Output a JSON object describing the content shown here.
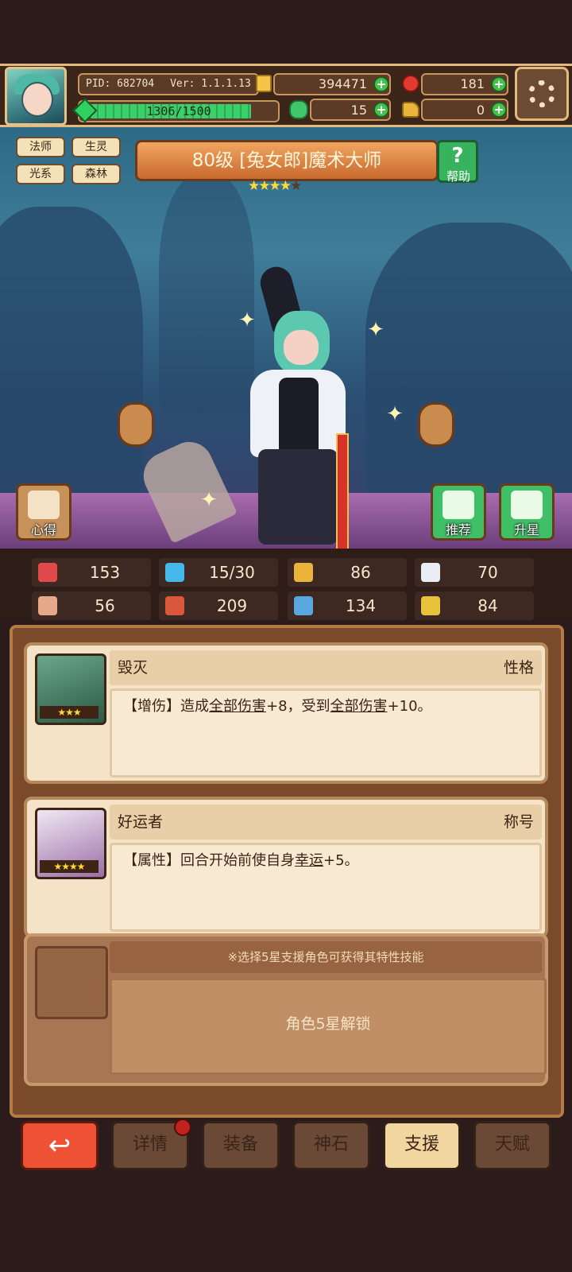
{
  "topbar": {
    "pid": "PID: 682704",
    "version": "Ver: 1.1.1.13",
    "gold": "394471",
    "rubies": "181",
    "energy": "1306/1500",
    "energy_fraction": 0.871,
    "clovers": "15",
    "keys": "0"
  },
  "tags": [
    "法师",
    "生灵",
    "光系",
    "森林"
  ],
  "hero": {
    "title": "80级 [兔女郎]魔术大师",
    "stars_filled": 4,
    "stars_total": 5,
    "help_label": "帮助"
  },
  "scene_buttons": {
    "insight": "心得",
    "recommend": "推荐",
    "star_up": "升星"
  },
  "stats": [
    {
      "icon": "heart-icon",
      "value": "153",
      "color": "#e04a4a"
    },
    {
      "icon": "drop-icon",
      "value": "15/30",
      "color": "#45b8e8"
    },
    {
      "icon": "shield-icon",
      "value": "86",
      "color": "#e9b33c"
    },
    {
      "icon": "wing-icon",
      "value": "70",
      "color": "#e8eef4"
    },
    {
      "icon": "fist-icon",
      "value": "56",
      "color": "#e8a88a"
    },
    {
      "icon": "book-icon",
      "value": "209",
      "color": "#d9583b"
    },
    {
      "icon": "boot-icon",
      "value": "134",
      "color": "#5aa7e0"
    },
    {
      "icon": "horseshoe-icon",
      "value": "84",
      "color": "#e9c23c"
    }
  ],
  "cards": [
    {
      "name": "毁灭",
      "kind": "性格",
      "stars": "★★★",
      "desc_tag": "【增伤】",
      "desc_a": "造成",
      "desc_u1": "全部伤害",
      "desc_b": "+8，受到",
      "desc_u2": "全部伤害",
      "desc_c": "+10。"
    },
    {
      "name": "好运者",
      "kind": "称号",
      "stars": "★★★★",
      "desc_tag": "【属性】",
      "desc_a": "回合开始前使自身",
      "desc_u1": "幸运",
      "desc_b": "+5。"
    }
  ],
  "lock": {
    "tip": "※选择5星支援角色可获得其特性技能",
    "message": "角色5星解锁"
  },
  "tabs": {
    "back": "↩",
    "details": "详情",
    "equip": "装备",
    "godstone": "神石",
    "support": "支援",
    "talent": "天赋"
  },
  "colors": {
    "accent": "#ef5135",
    "panel": "#7b4a2b",
    "card": "#f4e3c6"
  }
}
